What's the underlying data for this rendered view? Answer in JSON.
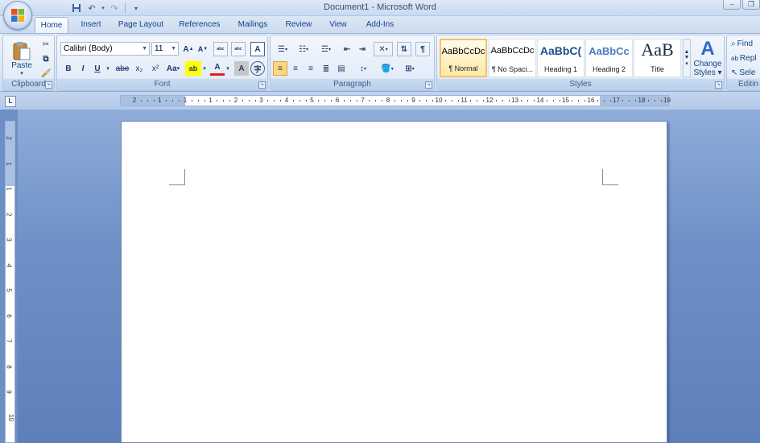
{
  "window": {
    "title": "Document1 - Microsoft Word"
  },
  "tabs": [
    "Home",
    "Insert",
    "Page Layout",
    "References",
    "Mailings",
    "Review",
    "View",
    "Add-Ins"
  ],
  "clipboard": {
    "paste_label": "Paste",
    "group_label": "Clipboard"
  },
  "font": {
    "group_label": "Font",
    "font_name": "Calibri (Body)",
    "font_size": "11",
    "grow": "A",
    "shrink": "A",
    "change_case": "Aa",
    "highlight": "ab",
    "font_color": "A",
    "char_shading": "A",
    "clear_format": "Aa",
    "bold": "B",
    "italic": "I",
    "underline": "U",
    "strike": "abe",
    "subscript": "x₂",
    "superscript": "x²"
  },
  "paragraph": {
    "group_label": "Paragraph"
  },
  "styles": {
    "group_label": "Styles",
    "items": [
      {
        "sample": "AaBbCcDc",
        "name": "¶ Normal"
      },
      {
        "sample": "AaBbCcDc",
        "name": "¶ No Spaci..."
      },
      {
        "sample": "AaBbC(",
        "name": "Heading 1"
      },
      {
        "sample": "AaBbCc",
        "name": "Heading 2"
      },
      {
        "sample": "AaB",
        "name": "Title"
      }
    ],
    "change_styles_line1": "Change",
    "change_styles_line2": "Styles"
  },
  "editing": {
    "group_label": "Editin",
    "find": "Find",
    "replace": "Repl",
    "select": "Sele"
  },
  "ruler": {
    "h_labels": [
      "2",
      "1",
      "1",
      "1",
      "2",
      "3",
      "4",
      "5",
      "6",
      "7",
      "8",
      "9",
      "10",
      "11",
      "12",
      "13",
      "14",
      "15",
      "16",
      "17",
      "18",
      "19"
    ],
    "v_labels": [
      "2",
      "1",
      "1",
      "2",
      "3",
      "4",
      "5",
      "6",
      "7",
      "8",
      "9",
      "10"
    ]
  },
  "colors": {
    "accent": "#15428b",
    "canvas": "#6c8fc6",
    "ribbon": "#dde8f6"
  }
}
